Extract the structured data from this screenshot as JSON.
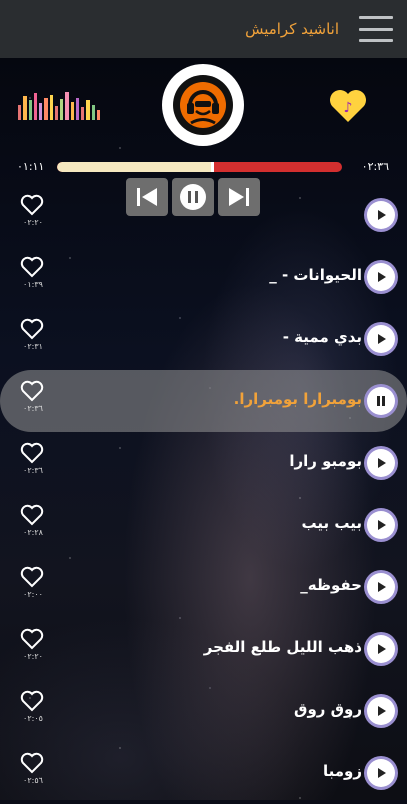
{
  "header": {
    "title": "اناشيد كراميش"
  },
  "player": {
    "elapsed": "٠١:١١",
    "total": "٠٢:٣٦",
    "progress_fraction": 0.54,
    "equalizer_colors": [
      "#e57373",
      "#ffb74d",
      "#81c784",
      "#f06292",
      "#ce93d8",
      "#ff8a65",
      "#ffd54f",
      "#e57373",
      "#aed581",
      "#f48fb1",
      "#ffb74d",
      "#ba68c8",
      "#e57373",
      "#ffd54f",
      "#81c784",
      "#ff8a65"
    ],
    "equalizer_levels": [
      0.55,
      0.85,
      0.7,
      0.95,
      0.6,
      0.8,
      0.9,
      0.5,
      0.75,
      1.0,
      0.65,
      0.8,
      0.45,
      0.7,
      0.55,
      0.35
    ]
  },
  "colors": {
    "accent": "#f1a23a",
    "progress_played": "#f5e8c0",
    "progress_remaining": "#d32f2f"
  },
  "tracks": [
    {
      "title": "",
      "duration": "٠٢:٢٠",
      "state": "play"
    },
    {
      "title": "الحيوانات - _",
      "duration": "٠١:٣٩",
      "state": "play"
    },
    {
      "title": "بدي ممية -",
      "duration": "٠٢:٣١",
      "state": "play"
    },
    {
      "title": "بومبرارا بومبرارا.",
      "duration": "٠٢:٣٦",
      "state": "pause"
    },
    {
      "title": "بومبو رارا",
      "duration": "٠٢:٣٦",
      "state": "play"
    },
    {
      "title": "بيب بيب",
      "duration": "٠٢:٢٨",
      "state": "play"
    },
    {
      "title": "حفوظه_",
      "duration": "٠٢:٠٠",
      "state": "play"
    },
    {
      "title": "ذهب الليل طلع الفجر",
      "duration": "٠٢:٢٠",
      "state": "play"
    },
    {
      "title": "روق روق",
      "duration": "٠٢:٠٥",
      "state": "play"
    },
    {
      "title": "زومبا",
      "duration": "٠٢:٥٦",
      "state": "play"
    }
  ]
}
